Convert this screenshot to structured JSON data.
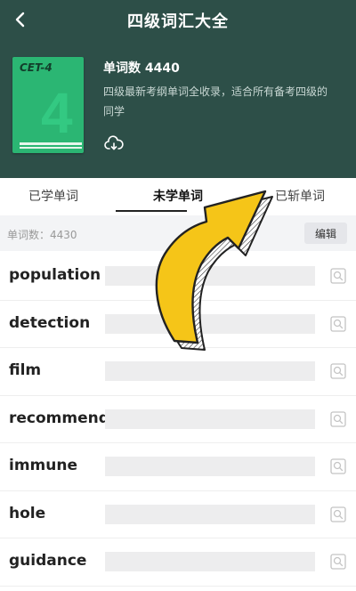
{
  "header": {
    "title": "四级词汇大全",
    "book_label": "CET-4",
    "book_big": "4",
    "word_count": "单词数 4440",
    "description": "四级最新考纲单词全收录，适合所有备考四级的同学"
  },
  "tabs": [
    {
      "label": "已学单词"
    },
    {
      "label": "未学单词",
      "active": true
    },
    {
      "label": "已斩单词"
    }
  ],
  "stats": {
    "text": "单词数：4430",
    "edit_label": "编辑"
  },
  "words": [
    {
      "word": "population"
    },
    {
      "word": "detection"
    },
    {
      "word": "film"
    },
    {
      "word": "recommend"
    },
    {
      "word": "immune"
    },
    {
      "word": "hole"
    },
    {
      "word": "guidance"
    }
  ],
  "colors": {
    "header_bg": "#2d4f48",
    "book_green": "#2bb673",
    "arrow_yellow": "#f5c518"
  },
  "icons": {
    "back": "chevron-left-icon",
    "cloud": "cloud-download-icon",
    "search": "search-icon"
  }
}
